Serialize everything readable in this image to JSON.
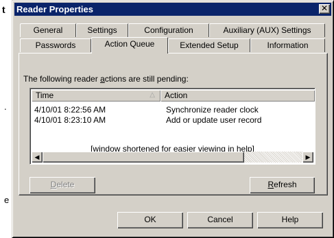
{
  "background_fragments": [
    "t",
    ".",
    "e"
  ],
  "window": {
    "title": "Reader Properties",
    "close_glyph": "✕"
  },
  "tabs_back_row": [
    "General",
    "Settings",
    "Configuration",
    "Auxiliary (AUX) Settings"
  ],
  "tabs_front_row": [
    "Passwords",
    "Action Queue",
    "Extended Setup",
    "Information"
  ],
  "active_tab": "Action Queue",
  "pending_label": {
    "pre": "The following reader ",
    "accel": "a",
    "post": "ctions are still pending:"
  },
  "list": {
    "columns": [
      "Time",
      "Action"
    ],
    "sort_icon": "sort-ascending-icon",
    "rows": [
      {
        "time": "4/10/01 8:22:56 AM",
        "action": "Synchronize reader clock"
      },
      {
        "time": "4/10/01 8:23:10 AM",
        "action": "Add or update user record"
      }
    ],
    "note": "[window shortened for easier viewing in help]"
  },
  "buttons": {
    "delete": {
      "accel": "D",
      "rest": "elete",
      "enabled": false
    },
    "refresh": {
      "accel": "R",
      "rest": "efresh",
      "enabled": true
    },
    "ok": "OK",
    "cancel": "Cancel",
    "help": "Help"
  },
  "colors": {
    "titlebar": "#0a246a",
    "face": "#d4d0c8"
  }
}
